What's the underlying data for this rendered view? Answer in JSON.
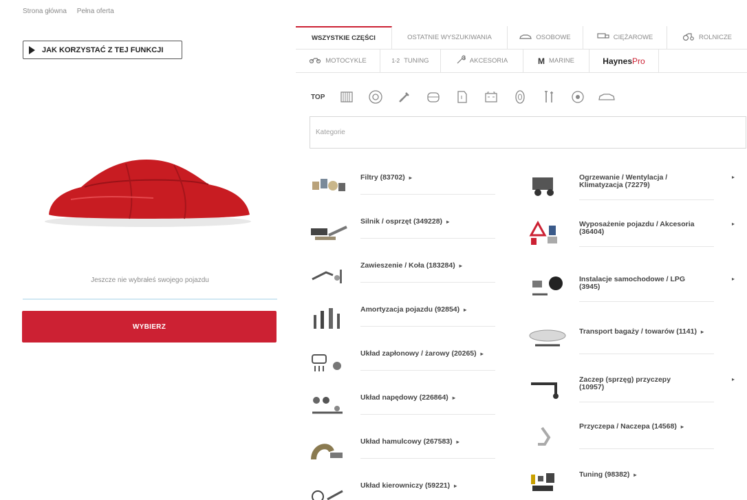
{
  "breadcrumb": [
    "Strona główna",
    "Pełna oferta"
  ],
  "howto": {
    "label": "JAK KORZYSTAĆ Z TEJ FUNKCJI"
  },
  "vehicle": {
    "empty_text": "Jeszcze nie wybrałeś swojego pojazdu",
    "choose_label": "WYBIERZ"
  },
  "tabs": {
    "row1": [
      "WSZYSTKIE CZĘŚCI",
      "OSTATNIE WYSZUKIWANIA",
      "OSOBOWE",
      "CIĘŻAROWE",
      "ROLNICZE"
    ],
    "row2": [
      "MOTOCYKLE",
      "TUNING",
      "AKCESORIA",
      "MARINE"
    ],
    "marine_letter": "M",
    "haynes_bold": "Haynes",
    "haynes_pro": "Pro",
    "tuning_prefix": "1-2"
  },
  "iconbar": {
    "top_label": "TOP",
    "icons": [
      "radiator-icon",
      "disc-icon",
      "spark-plug-icon",
      "engine-cover-icon",
      "fuel-filter-icon",
      "battery-icon",
      "wheel-icon",
      "tools-icon",
      "bearing-icon",
      "car-outline-icon"
    ]
  },
  "categories": {
    "placeholder": "Kategorie"
  },
  "left_categories": [
    {
      "label": "Filtry (83702)"
    },
    {
      "label": "Silnik / osprzęt (349228)"
    },
    {
      "label": "Zawieszenie / Koła (183284)"
    },
    {
      "label": "Amortyzacja pojazdu (92854)"
    },
    {
      "label": "Układ zapłonowy / żarowy (20265)"
    },
    {
      "label": "Układ napędowy (226864)"
    },
    {
      "label": "Układ hamulcowy (267583)"
    },
    {
      "label": "Układ kierowniczy (59221)"
    }
  ],
  "right_categories": [
    {
      "line1": "Ogrzewanie / Wentylacja /",
      "line2": "Klimatyzacja (72279)"
    },
    {
      "line1": "Wyposażenie pojazdu / Akcesoria",
      "line2": "(36404)"
    },
    {
      "line1": "Instalacje samochodowe / LPG",
      "line2": "(3945)"
    },
    {
      "line1": "Transport bagaży / towarów (1141)",
      "line2": ""
    },
    {
      "line1": "Zaczep (sprzęg) przyczepy",
      "line2": "(10957)"
    },
    {
      "line1": "Przyczepa / Naczepa (14568)",
      "line2": ""
    },
    {
      "line1": "Tuning (98382)",
      "line2": ""
    }
  ],
  "colors": {
    "accent": "#cc2133",
    "car": "#c81c22"
  }
}
